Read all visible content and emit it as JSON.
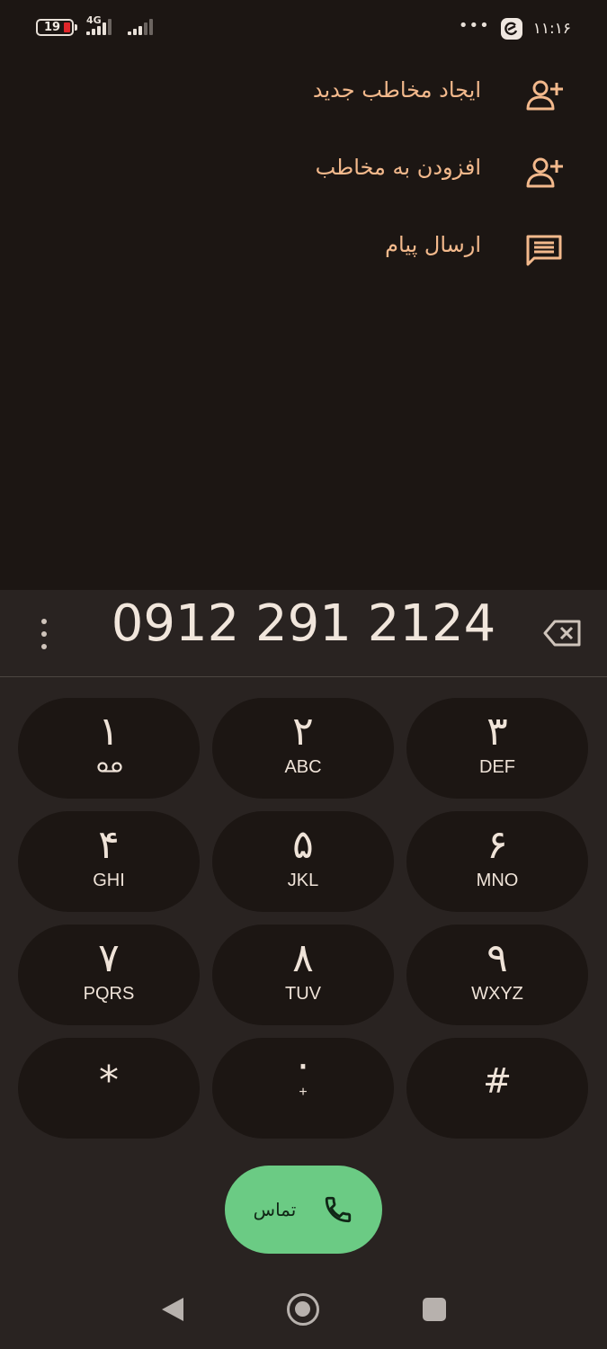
{
  "status_bar": {
    "battery_level": "19",
    "network_type": "4G",
    "menu_dots": "•••",
    "clock": "۱۱:۱۶"
  },
  "menu": {
    "items": [
      {
        "label": "ایجاد مخاطب جدید",
        "icon": "person-add-icon"
      },
      {
        "label": "افزودن به مخاطب",
        "icon": "person-add-icon"
      },
      {
        "label": "ارسال پیام",
        "icon": "message-icon"
      }
    ]
  },
  "dialer": {
    "number": "0912 291 2124",
    "keys": [
      {
        "digit": "۱",
        "letters": "",
        "extra": "voicemail-icon"
      },
      {
        "digit": "۲",
        "letters": "ABC"
      },
      {
        "digit": "۳",
        "letters": "DEF"
      },
      {
        "digit": "۴",
        "letters": "GHI"
      },
      {
        "digit": "۵",
        "letters": "JKL"
      },
      {
        "digit": "۶",
        "letters": "MNO"
      },
      {
        "digit": "۷",
        "letters": "PQRS"
      },
      {
        "digit": "۸",
        "letters": "TUV"
      },
      {
        "digit": "۹",
        "letters": "WXYZ"
      },
      {
        "digit": "*",
        "letters": ""
      },
      {
        "digit": "۰",
        "letters": "+"
      },
      {
        "digit": "#",
        "letters": ""
      }
    ],
    "call_label": "تماس"
  },
  "colors": {
    "accent": "#f3b98c",
    "call_button": "#6bcb84",
    "background": "#1c1613",
    "dialpad_background": "#292321"
  }
}
